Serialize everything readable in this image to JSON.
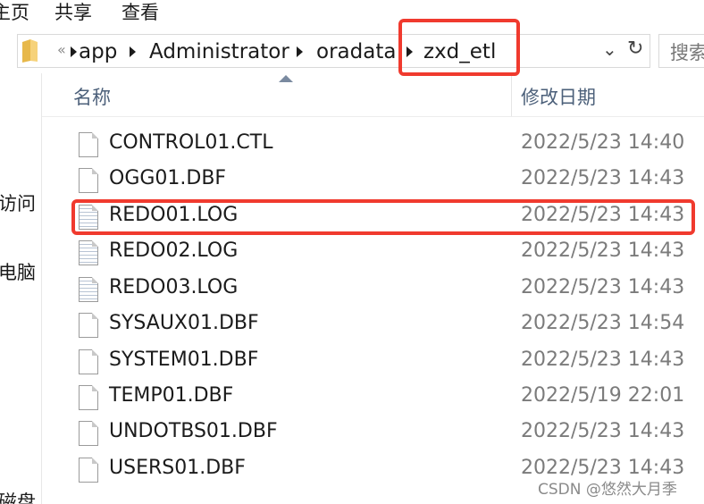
{
  "ribbon": {
    "home": "主页",
    "share": "共享",
    "view": "查看"
  },
  "address": {
    "overflow": "«",
    "crumbs": [
      "app",
      "Administrator",
      "oradata",
      "zxd_etl"
    ],
    "dropdown_icon": "chevron-down-icon",
    "refresh_icon": "refresh-icon"
  },
  "search": {
    "placeholder": "搜索"
  },
  "nav": {
    "item1": "访问",
    "item2": "电脑",
    "item3": "磁盘"
  },
  "columns": {
    "name": "名称",
    "date": "修改日期"
  },
  "files": [
    {
      "name": "CONTROL01.CTL",
      "date": "2022/5/23 14:40",
      "icon": "file-icon"
    },
    {
      "name": "OGG01.DBF",
      "date": "2022/5/23 14:43",
      "icon": "file-icon"
    },
    {
      "name": "REDO01.LOG",
      "date": "2022/5/23 14:43",
      "icon": "text-file-icon"
    },
    {
      "name": "REDO02.LOG",
      "date": "2022/5/23 14:43",
      "icon": "text-file-icon"
    },
    {
      "name": "REDO03.LOG",
      "date": "2022/5/23 14:43",
      "icon": "text-file-icon"
    },
    {
      "name": "SYSAUX01.DBF",
      "date": "2022/5/23 14:54",
      "icon": "file-icon"
    },
    {
      "name": "SYSTEM01.DBF",
      "date": "2022/5/23 14:43",
      "icon": "file-icon"
    },
    {
      "name": "TEMP01.DBF",
      "date": "2022/5/19 22:01",
      "icon": "file-icon"
    },
    {
      "name": "UNDOTBS01.DBF",
      "date": "2022/5/23 14:43",
      "icon": "file-icon"
    },
    {
      "name": "USERS01.DBF",
      "date": "2022/5/23 14:43",
      "icon": "file-icon"
    }
  ],
  "watermark": "CSDN @悠然大月季",
  "colors": {
    "highlight": "#f03a2e",
    "header_text": "#4c607a",
    "date_text": "#7b7b7b"
  }
}
